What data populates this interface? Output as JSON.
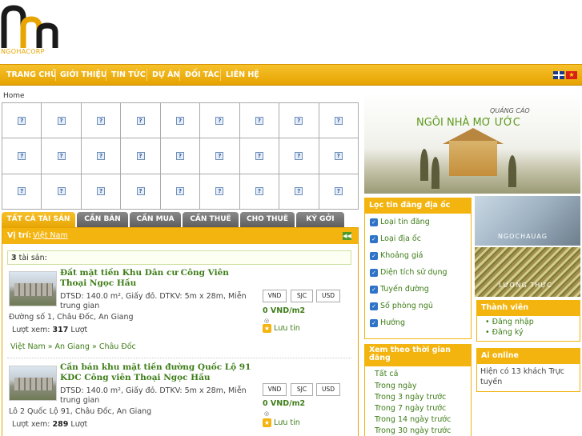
{
  "logo": {
    "text": "NGOHACORP"
  },
  "nav": {
    "items": [
      "TRANG CHỦ",
      "GIỚI THIỆU",
      "TIN TỨC",
      "DỰ ÁN",
      "ĐỐI TÁC",
      "LIÊN HỆ"
    ],
    "flags": [
      "english-flag-icon",
      "vietnam-flag-icon"
    ]
  },
  "breadcrumb": "Home",
  "grid_icon": "?",
  "tabs": [
    "TẤT CẢ TÀI SẢN",
    "CẦN BÁN",
    "CẦN MUA",
    "CẦN THUÊ",
    "CHO THUÊ",
    "KÝ GỞI"
  ],
  "location": {
    "label": "Vị trí:",
    "value": "Việt Nam"
  },
  "count": {
    "number": "3",
    "label": "tài sản:"
  },
  "listings": [
    {
      "title": "Đất mặt tiền Khu Dân cư Công Viên Thoại Ngọc Hầu",
      "desc": "DTSD: 140.0 m², Giấy đỏ. DTKV: 5m x 28m, Miễn trung gian",
      "address": "Đường số 1, Châu Đốc, An Giang",
      "views_label": "Lượt xem:",
      "views": "317",
      "views_unit": "Lượt",
      "price": "0 VND/m2",
      "save": "Lưu tin",
      "breadcrumb": "Việt Nam » An Giang » Châu Đốc"
    },
    {
      "title": "Cần bán khu mặt tiền đường Quốc Lộ 91 KDC Công viên Thoại Ngọc Hầu",
      "desc": "DTSD: 140.0 m², Giấy đỏ. DTKV: 5m x 28m, Miễn trung gian",
      "address": "Lô 2 Quốc Lộ 91, Châu Đốc, An Giang",
      "views_label": "Lượt xem:",
      "views": "289",
      "views_unit": "Lượt",
      "price": "0 VND/m2",
      "save": "Lưu tin"
    }
  ],
  "currency": [
    "VND",
    "SJC",
    "USD"
  ],
  "banner": {
    "small": "QUẢNG CÁO",
    "big": "NGÔI NHÀ MƠ ƯỚC"
  },
  "filter": {
    "title": "Lọc tin đăng địa ốc",
    "items": [
      "Loại tin đăng",
      "Loại địa ốc",
      "Khoảng giá",
      "Diện tích sử dụng",
      "Tuyến đường",
      "Số phòng ngủ",
      "Hướng"
    ]
  },
  "time_filter": {
    "title": "Xem theo thời gian đăng",
    "items": [
      "Tất cả",
      "Trong ngày",
      "Trong 3 ngày trước",
      "Trong 7 ngày trước",
      "Trong 14 ngày trước",
      "Trong 30 ngày trước"
    ]
  },
  "ads": [
    "NGOCHAUAG",
    "LƯƠNG THỰC"
  ],
  "members": {
    "title": "Thành viên",
    "items": [
      "Đăng nhập",
      "Đăng ký"
    ]
  },
  "online": {
    "title": "Ai online",
    "text": "Hiện có 13 khách Trực tuyến"
  }
}
